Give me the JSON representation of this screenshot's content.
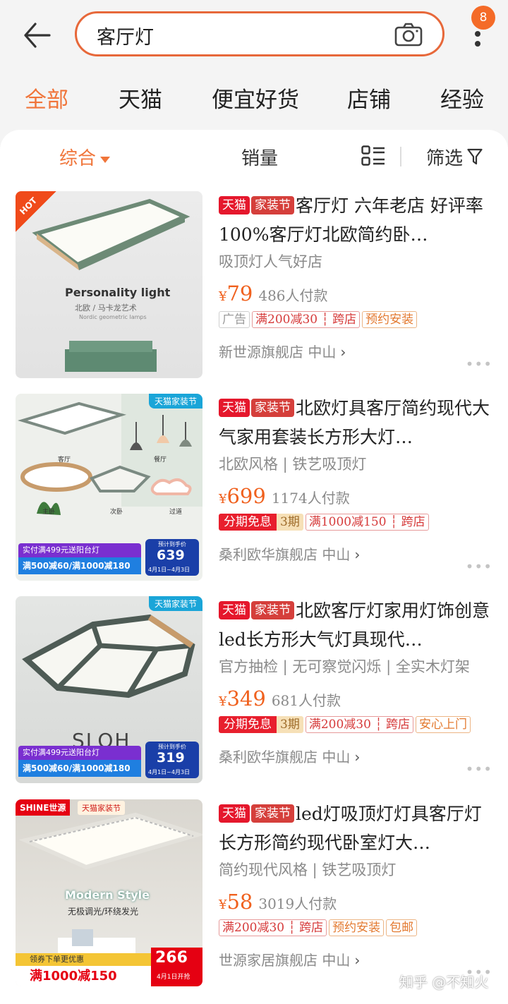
{
  "search": {
    "query": "客厅灯",
    "cart_badge": "8"
  },
  "tabs": [
    "全部",
    "天猫",
    "便宜好货",
    "店铺",
    "经验"
  ],
  "sort": {
    "comprehensive": "综合",
    "sales": "销量",
    "filter": "筛选"
  },
  "products": [
    {
      "title_tags": [
        "天猫",
        "家装节"
      ],
      "title": "客厅灯 六年老店 好评率100%客厅灯北欧简约卧…",
      "sub": "吸顶灯人气好店",
      "price": "79",
      "paid": "486人付款",
      "promo": [
        "广告",
        "满200减30",
        "跨店",
        "预约安装"
      ],
      "shop": "新世源旗舰店",
      "city": "中山",
      "thumb": {
        "corner": "HOT",
        "headline": "Personality light",
        "line1": "北欧 / 马卡龙艺术",
        "line2": "Nordic geometric lamps"
      }
    },
    {
      "title_tags": [
        "天猫",
        "家装节"
      ],
      "title": "北欧灯具客厅简约现代大气家用套装长方形大灯…",
      "sub": "北欧风格 | 铁艺吸顶灯",
      "price": "699",
      "paid": "1174人付款",
      "promo": [
        "分期免息",
        "3期",
        "满1000减150",
        "跨店"
      ],
      "shop": "桑利欧华旗舰店",
      "city": "中山",
      "thumb": {
        "corner": "天猫家装节",
        "rooms": [
          "客厅",
          "餐厅",
          "主卧",
          "次卧",
          "过道"
        ],
        "banner1": "实付满499元送阳台灯",
        "banner2": "满500减60/满1000减180",
        "pre": "预计到手价",
        "price": "639",
        "dates": "4月1日~4月3日"
      }
    },
    {
      "title_tags": [
        "天猫",
        "家装节"
      ],
      "title": "北欧客厅灯家用灯饰创意led长方形大气灯具现代…",
      "sub": "官方抽检 | 无可察觉闪烁 | 全实木灯架",
      "price": "349",
      "paid": "681人付款",
      "promo": [
        "分期免息",
        "3期",
        "满200减30",
        "跨店",
        "安心上门"
      ],
      "shop": "桑利欧华旗舰店",
      "city": "中山",
      "thumb": {
        "corner": "天猫家装节",
        "brand": "SLOH",
        "banner1": "实付满499元送阳台灯",
        "banner2": "满500减60/满1000减180",
        "pre": "预计到手价",
        "price": "319",
        "dates": "4月1日~4月3日"
      }
    },
    {
      "title_tags": [
        "天猫",
        "家装节"
      ],
      "title": "led灯吸顶灯灯具客厅灯长方形简约现代卧室灯大…",
      "sub": "简约现代风格 | 铁艺吸顶灯",
      "price": "58",
      "paid": "3019人付款",
      "promo": [
        "满200减30",
        "跨店",
        "预约安装",
        "包邮"
      ],
      "shop": "世源家居旗舰店",
      "city": "中山",
      "thumb": {
        "brand": "SHINE世源",
        "corner": "天猫家装节",
        "headline": "Modern Style",
        "line1": "无极调光/环绕发光",
        "coupon": "领券下单更优惠",
        "big": "满1000减150",
        "price": "266",
        "date": "4月1日开抢"
      }
    }
  ],
  "watermark": "知乎 @不知火",
  "colors": {
    "accent": "#f0753a",
    "price": "#f0611e",
    "tmall_red": "#e5172c"
  }
}
